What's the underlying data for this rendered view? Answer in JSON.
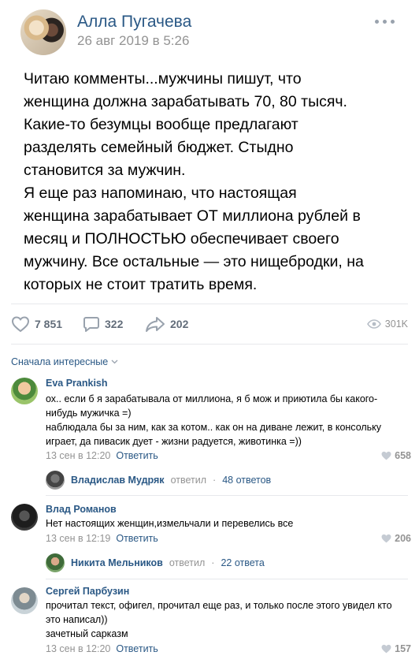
{
  "post": {
    "author": "Алла Пугачева",
    "date": "26 авг 2019 в 5:26",
    "lines": [
      "Читаю комменты...мужчины пишут, что",
      "женщина должна зарабатывать 70, 80 тысяч.",
      "Какие-то безумцы вообще предлагают",
      "разделять семейный бюджет. Стыдно",
      "становится за мужчин.",
      "Я еще раз напоминаю, что настоящая",
      "женщина зарабатывает ОТ миллиона рублей в",
      "месяц и ПОЛНОСТЬЮ обеспечивает своего",
      "мужчину. Все остальные — это нищебродки, на",
      "которых не стоит тратить время."
    ],
    "likes": "7 851",
    "comments": "322",
    "shares": "202",
    "views": "301K"
  },
  "sort_label": "Сначала интересные",
  "comments": [
    {
      "author": "Eva Prankish",
      "lines": [
        "ох.. если б я зарабатывала от миллиона, я б мож и приютила бы какого-",
        "нибудь мужичка =)",
        "наблюдала бы за ним, как за котом.. как он на диване лежит, в консольку",
        "играет, да пивасик дует - жизни радуется, животинка =))"
      ],
      "date": "13 сен в 12:20",
      "reply_label": "Ответить",
      "likes": "658",
      "replies": {
        "name": "Владислав Мудряк",
        "verb": "ответил",
        "count": "48 ответов"
      }
    },
    {
      "author": "Влад Романов",
      "lines": [
        "Нет настоящих женщин,измельчали и перевелись все"
      ],
      "date": "13 сен в 12:19",
      "reply_label": "Ответить",
      "likes": "206",
      "replies": {
        "name": "Никита Мельников",
        "verb": "ответил",
        "count": "22 ответа"
      }
    },
    {
      "author": "Сергей Парбузин",
      "lines": [
        "прочитал текст, офигел, прочитал еще раз, и только после этого увидел кто",
        "это написал))",
        "зачетный сарказм"
      ],
      "date": "13 сен в 12:20",
      "reply_label": "Ответить",
      "likes": "157"
    }
  ],
  "colors": {
    "link": "#2a5885",
    "muted": "#939393",
    "icon": "#99a2ad",
    "divider": "#e7e8ec"
  }
}
